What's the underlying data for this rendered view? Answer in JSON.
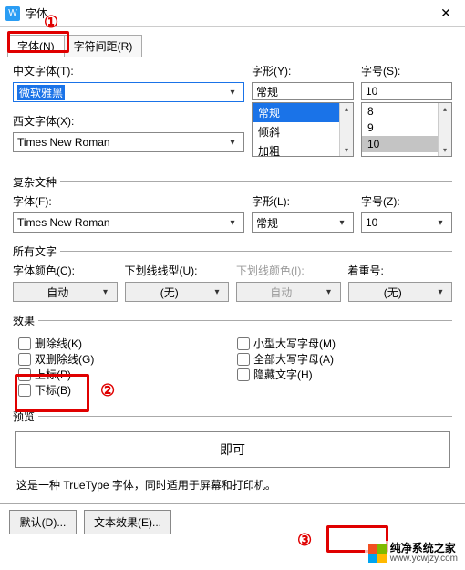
{
  "window": {
    "title": "字体",
    "app_icon_letter": "W"
  },
  "tabs": {
    "font": "字体(N)",
    "spacing": "字符间距(R)"
  },
  "cn": {
    "font_label": "中文字体(T):",
    "font_value": "微软雅黑",
    "style_label": "字形(Y):",
    "style_value": "常规",
    "style_options": [
      "常规",
      "倾斜",
      "加粗"
    ],
    "size_label": "字号(S):",
    "size_value": "10",
    "size_options": [
      "8",
      "9",
      "10"
    ]
  },
  "west": {
    "font_label": "西文字体(X):",
    "font_value": "Times New Roman"
  },
  "complex": {
    "legend": "复杂文种",
    "font_label": "字体(F):",
    "font_value": "Times New Roman",
    "style_label": "字形(L):",
    "style_value": "常规",
    "size_label": "字号(Z):",
    "size_value": "10"
  },
  "alltext": {
    "legend": "所有文字",
    "color_label": "字体颜色(C):",
    "color_value": "自动",
    "underline_label": "下划线线型(U):",
    "underline_value": "(无)",
    "underline_color_label": "下划线颜色(I):",
    "underline_color_value": "自动",
    "emphasis_label": "着重号:",
    "emphasis_value": "(无)"
  },
  "effects": {
    "legend": "效果",
    "strike": "删除线(K)",
    "dstrike": "双删除线(G)",
    "superscript": "上标(P)",
    "subscript": "下标(B)",
    "smallcaps": "小型大写字母(M)",
    "allcaps": "全部大写字母(A)",
    "hidden": "隐藏文字(H)"
  },
  "preview": {
    "legend": "预览",
    "sample": "即可"
  },
  "description": "这是一种 TrueType 字体，同时适用于屏幕和打印机。",
  "buttons": {
    "default": "默认(D)...",
    "texteffects": "文本效果(E)..."
  },
  "watermark": {
    "name": "纯净系统之家",
    "url": "www.ycwjzy.com"
  },
  "annotations": {
    "n1": "①",
    "n2": "②",
    "n3": "③"
  }
}
